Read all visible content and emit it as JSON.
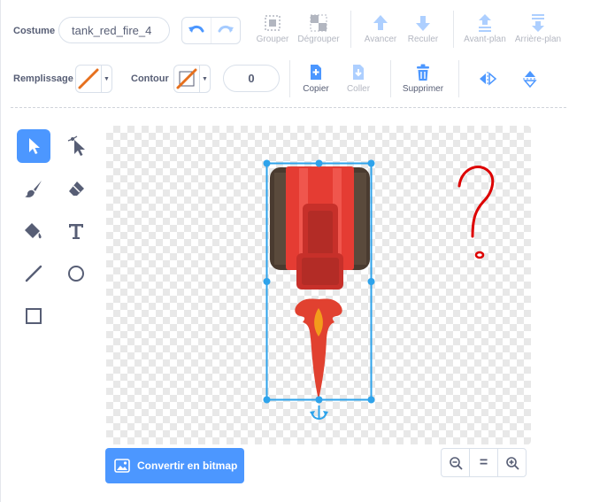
{
  "costume": {
    "label": "Costume",
    "name": "tank_red_fire_4"
  },
  "toolbar_top": {
    "group": "Grouper",
    "ungroup": "Dégrouper",
    "forward": "Avancer",
    "backward": "Reculer",
    "front": "Avant-plan",
    "back": "Arrière-plan"
  },
  "fill": {
    "label": "Remplissage",
    "color": "#e6701e"
  },
  "outline": {
    "label": "Contour",
    "color": "#e6701e",
    "width": "0"
  },
  "toolbar_bottom": {
    "copy": "Copier",
    "paste": "Coller",
    "delete": "Supprimer"
  },
  "tools": [
    "select",
    "reshape",
    "brush",
    "eraser",
    "fill",
    "text",
    "line",
    "circle",
    "rectangle"
  ],
  "convert_button": "Convertir en bitmap",
  "zoom": {
    "out": "zoom-out-icon",
    "reset": "=",
    "in": "zoom-in-icon"
  },
  "colors": {
    "accent": "#4c97ff",
    "text": "#575e75",
    "tank_red": "#e53c33",
    "tank_dark": "#4a3b30",
    "flame_red": "#e14130",
    "flame_orange": "#f39c1b",
    "annotation_red": "#dd0000"
  }
}
